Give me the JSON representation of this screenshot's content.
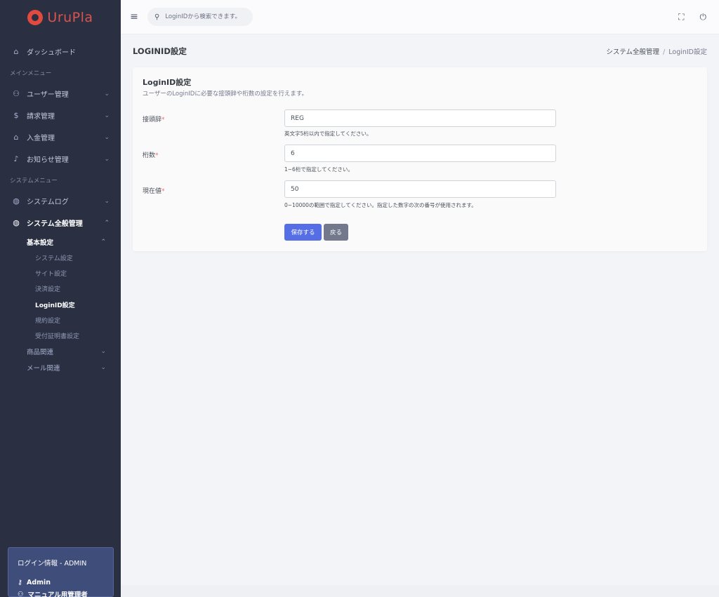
{
  "brand": {
    "name": "UruPla",
    "color": "#e04a3f"
  },
  "sidebar": {
    "dashboard": {
      "label": "ダッシュボード",
      "icon": "home-icon"
    },
    "main_menu_heading": "メインメニュー",
    "main_items": [
      {
        "label": "ユーザー管理",
        "icon": "user-icon"
      },
      {
        "label": "請求管理",
        "icon": "dollar-icon"
      },
      {
        "label": "入金管理",
        "icon": "bank-icon"
      },
      {
        "label": "お知らせ管理",
        "icon": "bell-icon"
      }
    ],
    "system_menu_heading": "システムメニュー",
    "system_log": {
      "label": "システムログ",
      "icon": "globe-icon"
    },
    "system_general": {
      "label": "システム全般管理",
      "icon": "globe-icon"
    },
    "basic_settings": {
      "label": "基本設定"
    },
    "basic_sub_items": [
      {
        "label": "システム設定"
      },
      {
        "label": "サイト設定"
      },
      {
        "label": "決済設定"
      },
      {
        "label": "LoginID設定"
      },
      {
        "label": "規約設定"
      },
      {
        "label": "受付証明書設定"
      }
    ],
    "product_related": {
      "label": "商品関連"
    },
    "mail_related": {
      "label": "メール関連"
    }
  },
  "login_info": {
    "title": "ログイン情報 - ADMIN",
    "user": "Admin",
    "role": "マニュアル用管理者"
  },
  "topbar": {
    "search_placeholder": "LoginIDから検索できます。"
  },
  "page": {
    "title": "LOGINID設定",
    "breadcrumb": {
      "parent": "システム全般管理",
      "separator": "/",
      "current": "LoginID設定"
    }
  },
  "card": {
    "title": "LoginID設定",
    "description": "ユーザーのLoginIDに必要な接頭辞や桁数の設定を行えます。",
    "fields": [
      {
        "label": "接頭辞",
        "required_mark": "*",
        "value": "REG",
        "help": "英文字5桁以内で指定してください。"
      },
      {
        "label": "桁数",
        "required_mark": "*",
        "value": "6",
        "help": "1~6桁で指定してください。"
      },
      {
        "label": "現在値",
        "required_mark": "*",
        "value": "50",
        "help": "0~10000の範囲で指定してください。指定した数字の次の番号が使用されます。"
      }
    ],
    "save_label": "保存する",
    "back_label": "戻る"
  },
  "colors": {
    "sidebar_bg": "#2a3042",
    "primary": "#556ee6",
    "secondary": "#74788d",
    "required": "#f46a6a"
  }
}
